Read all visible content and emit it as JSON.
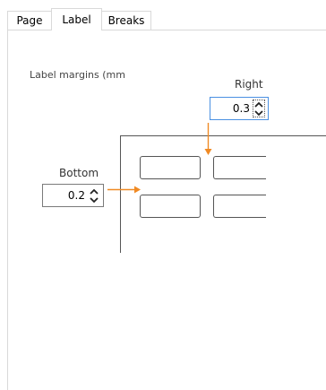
{
  "tabs": [
    {
      "label": "Page",
      "active": false
    },
    {
      "label": "Label",
      "active": true
    },
    {
      "label": "Breaks",
      "active": false
    }
  ],
  "section_label": "Label margins (mm",
  "right_margin": {
    "label": "Right",
    "value": "0.3",
    "focused": true
  },
  "bottom_margin": {
    "label": "Bottom",
    "value": "0.2",
    "focused": false
  },
  "colors": {
    "arrow": "#f08a24",
    "focus_border": "#4a90e2",
    "line": "#555555"
  },
  "icons": {
    "spin_up": "caret-up-icon",
    "spin_down": "caret-down-icon"
  }
}
